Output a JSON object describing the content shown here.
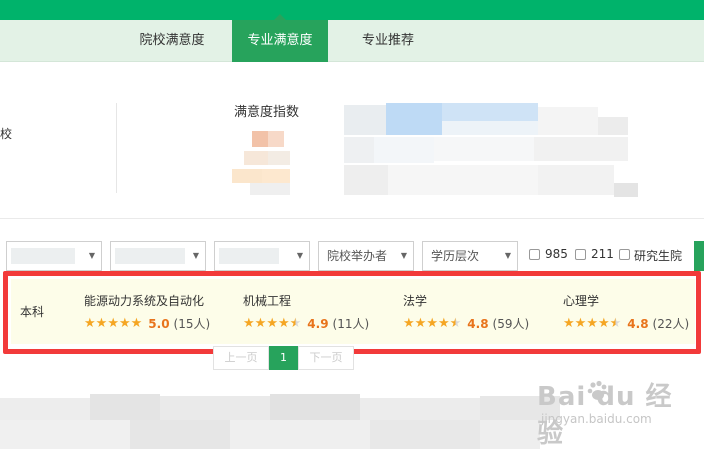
{
  "tabs": [
    {
      "label": "院校满意度",
      "active": false
    },
    {
      "label": "专业满意度",
      "active": true
    },
    {
      "label": "专业推荐",
      "active": false
    }
  ],
  "summary": {
    "school_fragment": "校",
    "satisfaction_title": "满意度指数"
  },
  "filters": {
    "selects": [
      {
        "label": "",
        "blurred": true
      },
      {
        "label": "",
        "blurred": true
      },
      {
        "label": "",
        "blurred": true
      },
      {
        "label": "院校举办者",
        "blurred": false
      },
      {
        "label": "学历层次",
        "blurred": false
      }
    ],
    "checkboxes": [
      "985",
      "211",
      "研究生院"
    ]
  },
  "result_row": {
    "level": "本科",
    "majors": [
      {
        "name": "能源动力系统及自动化",
        "rating": 5.0,
        "score": "5.0",
        "count": "(15人)"
      },
      {
        "name": "机械工程",
        "rating": 4.9,
        "score": "4.9",
        "count": "(11人)"
      },
      {
        "name": "法学",
        "rating": 4.8,
        "score": "4.8",
        "count": "(59人)"
      },
      {
        "name": "心理学",
        "rating": 4.8,
        "score": "4.8",
        "count": "(22人)"
      }
    ]
  },
  "pagination": {
    "prev": "上一页",
    "current": "1",
    "next": "下一页"
  },
  "watermark": {
    "main": "Bai du 经验",
    "sub": "jingyan.baidu.com"
  },
  "colors": {
    "brand_green": "#00b36b",
    "tab_active": "#27a35c",
    "highlight": "#f23a3a",
    "star": "#f5a623",
    "score": "#e8741c"
  }
}
